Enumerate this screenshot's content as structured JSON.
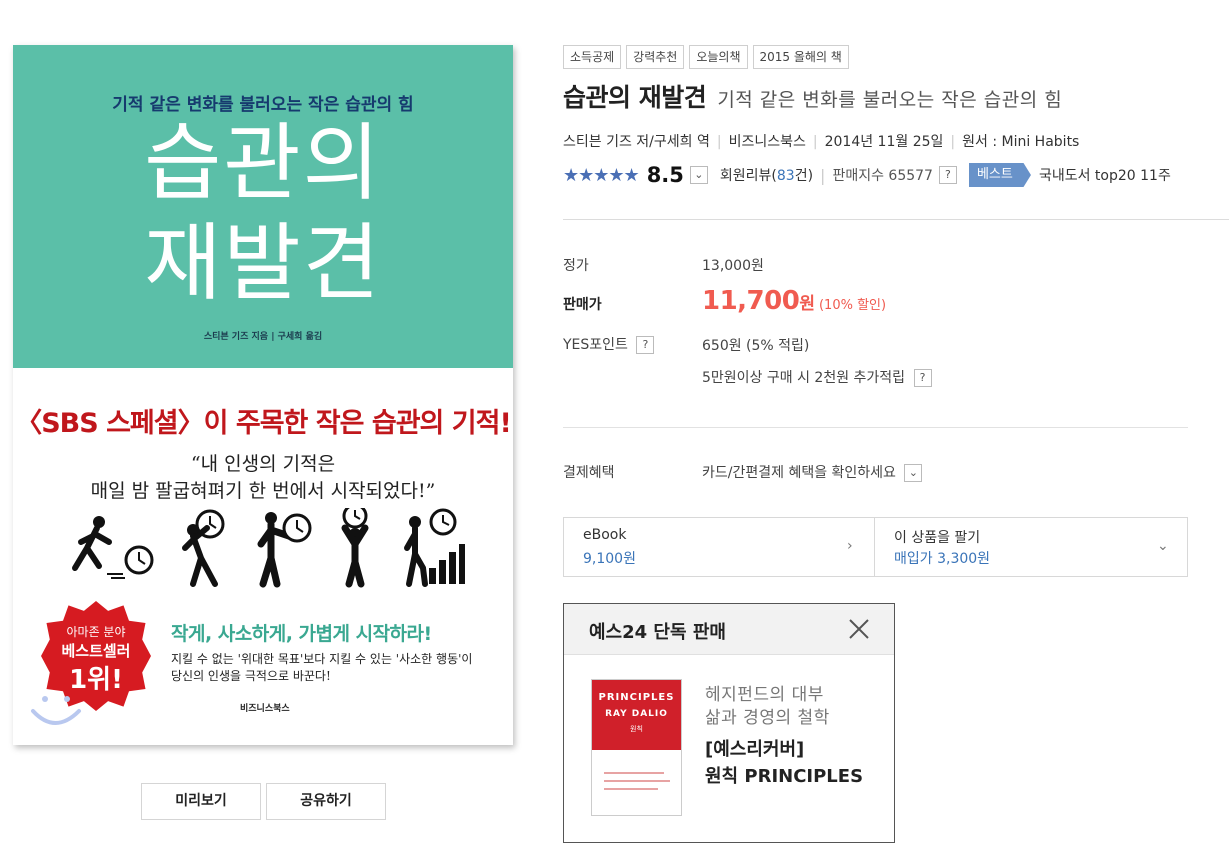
{
  "cover": {
    "subtitle": "기적 같은 변화를 불러오는 작은 습관의 힘",
    "title_line1": "습관의",
    "title_line2": "재발견",
    "author": "스티븐 기즈 지음 | 구세희 옮김",
    "headline": "〈SBS 스페셜〉이 주목한 작은 습관의 기적!",
    "quote_line1": "“내 인생의 기적은",
    "quote_line2": "매일 밤 팔굽혀펴기 한 번에서 시작되었다!”",
    "badge_line1": "아마존 분야",
    "badge_line2": "베스트셀러",
    "badge_line3": "1위!",
    "teal_line": "작게, 사소하게, 가볍게 시작하라!",
    "small_line1": "지킬 수 없는 '위대한 목표'보다 지킬 수 있는 '사소한 행동'이",
    "small_line2": "당신의 인생을 극적으로 바꾼다!",
    "publisher_logo": "비즈니스북스",
    "colors": {
      "teal": "#5bbfa8",
      "red": "#c0171c",
      "navy": "#163a6e"
    }
  },
  "cover_buttons": {
    "preview": "미리보기",
    "share": "공유하기"
  },
  "tags": [
    "소득공제",
    "강력추천",
    "오늘의책",
    "2015 올해의 책"
  ],
  "product": {
    "title": "습관의 재발견",
    "subtitle": "기적 같은 변화를 불러오는 작은 습관의 힘",
    "author": "스티븐 기즈 저/구세희 역",
    "publisher": "비즈니스북스",
    "date": "2014년 11월 25일",
    "original": "원서 : Mini Habits"
  },
  "rating": {
    "stars": "★★★★★",
    "score": "8.5",
    "review_prefix": "회원리뷰(",
    "review_count": "83",
    "review_suffix": "건)",
    "sales_index": "판매지수 65577",
    "help_mark": "?",
    "best_label": "베스트",
    "best_desc": "국내도서 top20 11주"
  },
  "pricing": {
    "list_label": "정가",
    "list_price": "13,000원",
    "sale_label": "판매가",
    "sale_price": "11,700",
    "sale_unit": "원",
    "discount": "(10% 할인)",
    "point_label": "YES포인트",
    "point_value": "650원 (5% 적립)",
    "bonus_point": "5만원이상 구매 시 2천원 추가적립",
    "payment_label": "결제혜택",
    "payment_value": "카드/간편결제 혜택을 확인하세요"
  },
  "ebook": {
    "label": "eBook",
    "price": "9,100원",
    "sell_label": "이 상품을 팔기",
    "sell_price": "매입가 3,300원"
  },
  "promo": {
    "header": "예스24 단독 판매",
    "book_title": "PRINCIPLES",
    "book_author": "RAY DALIO",
    "book_kr": "원칙",
    "desc1": "헤지펀드의 대부",
    "desc2": "삶과 경영의 철학",
    "name1": "[예스리커버]",
    "name2": "원칙 PRINCIPLES"
  },
  "icons": {
    "dropdown": "chevron-down-icon",
    "arrow": "chevron-right-icon",
    "close": "close-icon"
  }
}
